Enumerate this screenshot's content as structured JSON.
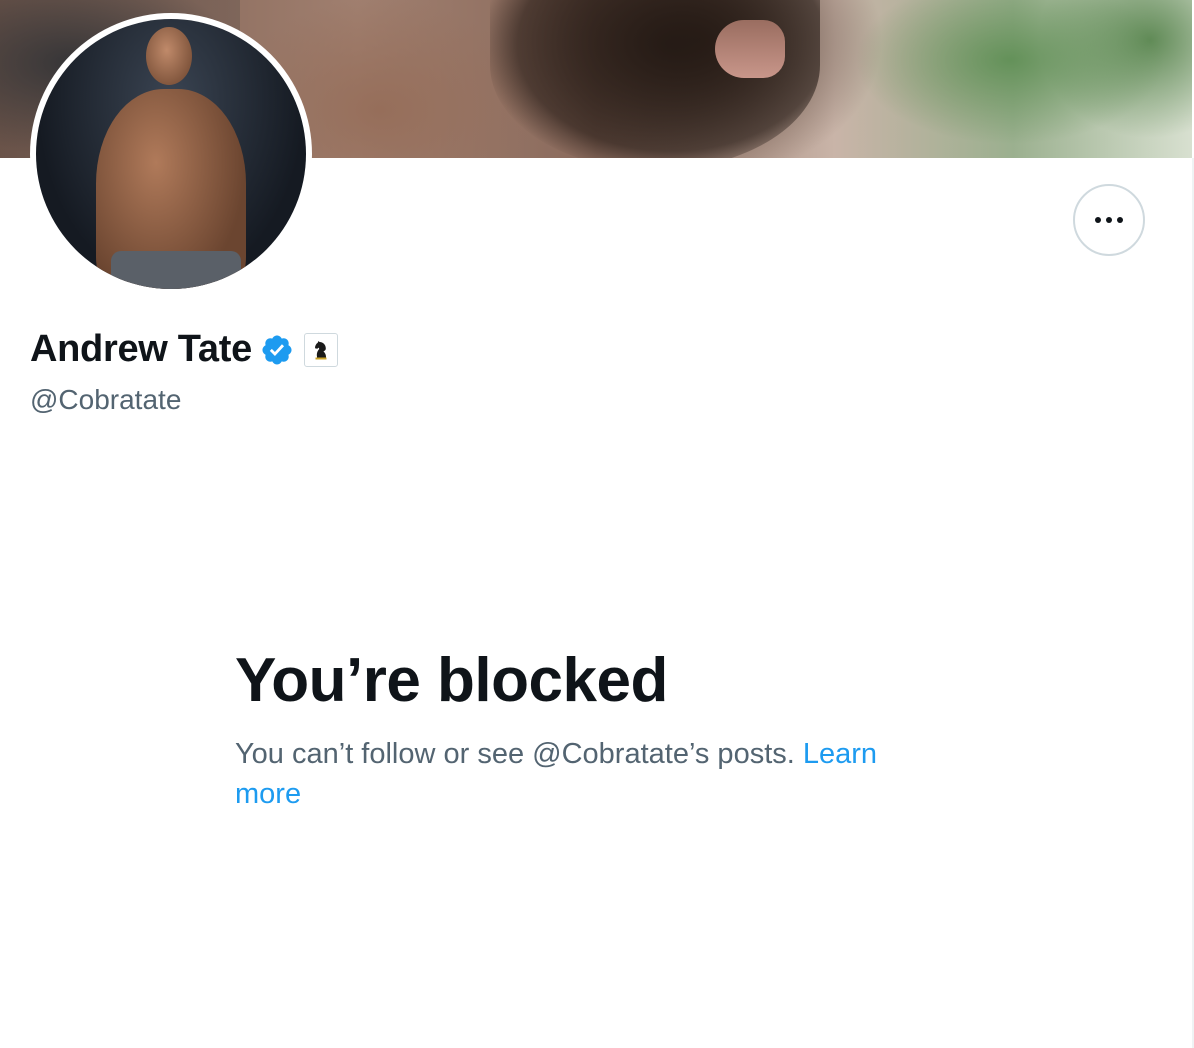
{
  "profile": {
    "display_name": "Andrew Tate",
    "handle": "@Cobratate",
    "verified_icon": "verified-badge-icon",
    "affiliate_icon": "chess-knight-icon"
  },
  "actions": {
    "more_icon": "more-options-icon"
  },
  "blocked": {
    "title": "You’re blocked",
    "message": "You can’t follow or see @Cobratate’s posts. ",
    "learn_more": "Learn more"
  },
  "colors": {
    "accent": "#1d9bf0",
    "text_primary": "#0f1419",
    "text_secondary": "#536471",
    "border": "#cfd9de"
  }
}
